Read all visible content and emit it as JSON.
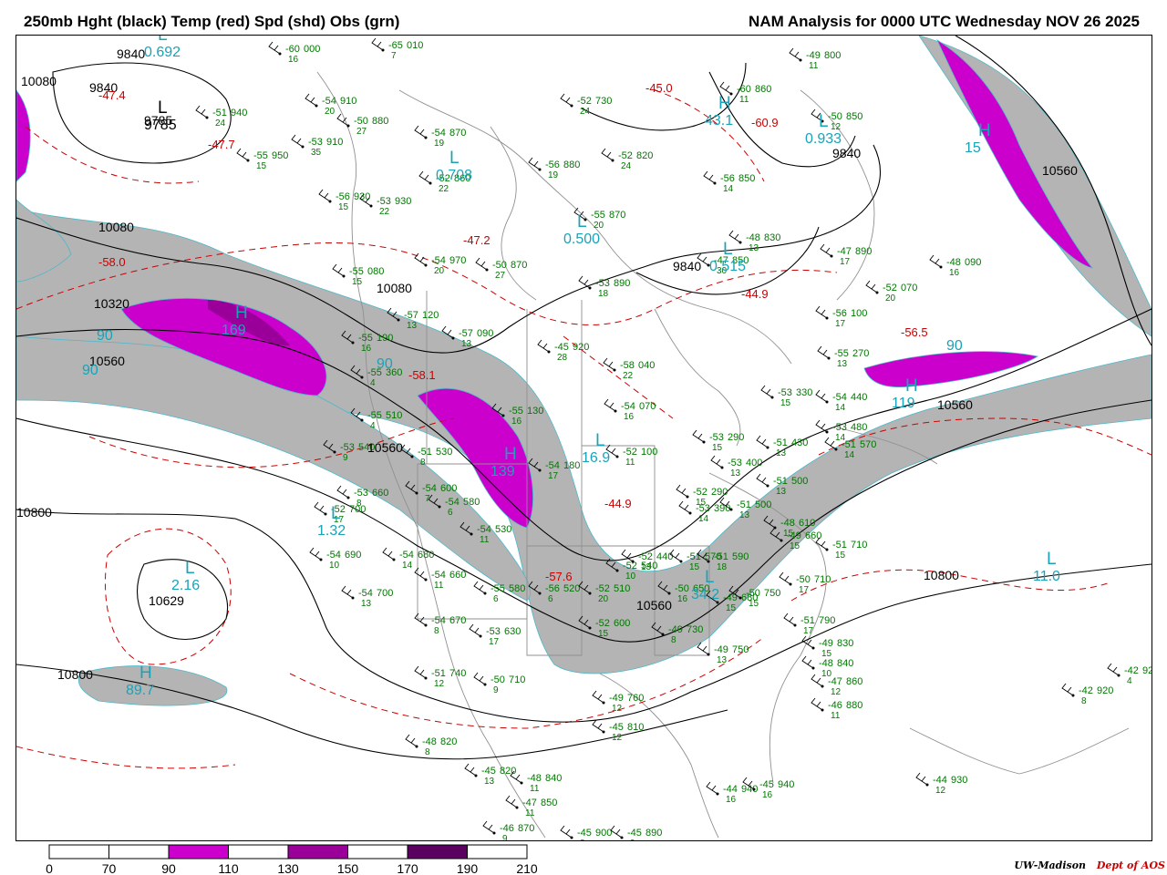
{
  "header": {
    "title_left": "250mb Hght (black) Temp (red) Spd (shd) Obs (grn)",
    "title_right": "NAM Analysis for 0000 UTC Wednesday  NOV 26 2025"
  },
  "colors": {
    "height": "#000000",
    "temperature": "#cc0000",
    "observations": "#007700",
    "speed_label": "#1aa3b8",
    "geography": "#909090",
    "shade_70": "#b4b4b4",
    "shade_110": "#cc00cc",
    "shade_150": "#9a0099",
    "shade_190": "#5a0060"
  },
  "speed_colorbar": {
    "ticks": [
      "0",
      "70",
      "90",
      "110",
      "130",
      "150",
      "170",
      "190",
      "210"
    ],
    "segment_colors": [
      "#ffffff",
      "#b4b4b4",
      "#ffffff",
      "#cc00cc",
      "#ffffff",
      "#9a0099",
      "#ffffff",
      "#5a0060",
      "#ffffff"
    ]
  },
  "height_labels": [
    "9840",
    "10080",
    "9840",
    "9785",
    "10080",
    "10320",
    "10560",
    "10080",
    "10560",
    "10800",
    "10629",
    "10800",
    "10560",
    "10800",
    "10560",
    "9840",
    "9840",
    "10560"
  ],
  "temperature_labels": [
    "-47.4",
    "-47.7",
    "-47.2",
    "-58.0",
    "-58.1",
    "-45.0",
    "-60.9",
    "-44.9",
    "-56.5",
    "-57.6",
    "-44.9"
  ],
  "pressure_centers": [
    {
      "letter": "L",
      "value": "0.692"
    },
    {
      "letter": "L",
      "value": "9785"
    },
    {
      "letter": "L",
      "value": "0.708"
    },
    {
      "letter": "L",
      "value": "0.500"
    },
    {
      "letter": "L",
      "value": "0.515"
    },
    {
      "letter": "H",
      "value": "43.1"
    },
    {
      "letter": "L",
      "value": "0.933"
    },
    {
      "letter": "H",
      "value": "15"
    },
    {
      "letter": "H",
      "value": "169"
    },
    {
      "letter": "H",
      "value": "119"
    },
    {
      "letter": "L",
      "value": "1.32"
    },
    {
      "letter": "L",
      "value": "2.16"
    },
    {
      "letter": "L",
      "value": "11.0"
    },
    {
      "letter": "H",
      "value": "89.7"
    },
    {
      "letter": "L",
      "value": "16.9"
    },
    {
      "letter": "L",
      "value": "34.2"
    },
    {
      "letter": "H",
      "value": "139"
    }
  ],
  "speed_labels": [
    "90",
    "90",
    "90",
    "90"
  ],
  "observations": [
    {
      "t": "-60",
      "h": "000",
      "s": "16"
    },
    {
      "t": "-65",
      "h": "010",
      "s": "7"
    },
    {
      "t": "-51",
      "h": "940",
      "s": "24"
    },
    {
      "t": "-54",
      "h": "910",
      "s": "20"
    },
    {
      "t": "-50",
      "h": "880",
      "s": "27"
    },
    {
      "t": "-53",
      "h": "910",
      "s": "35"
    },
    {
      "t": "-55",
      "h": "950",
      "s": "15"
    },
    {
      "t": "-54",
      "h": "870",
      "s": "19"
    },
    {
      "t": "-52",
      "h": "860",
      "s": "22"
    },
    {
      "t": "-56",
      "h": "930",
      "s": "15"
    },
    {
      "t": "-53",
      "h": "930",
      "s": "22"
    },
    {
      "t": "-54",
      "h": "970",
      "s": "20"
    },
    {
      "t": "-50",
      "h": "870",
      "s": "27"
    },
    {
      "t": "-55",
      "h": "080",
      "s": "15"
    },
    {
      "t": "-57",
      "h": "120",
      "s": "13"
    },
    {
      "t": "-57",
      "h": "090",
      "s": "13"
    },
    {
      "t": "-55",
      "h": "190",
      "s": "16"
    },
    {
      "t": "-56",
      "h": "880",
      "s": "19"
    },
    {
      "t": "-52",
      "h": "820",
      "s": "24"
    },
    {
      "t": "-52",
      "h": "730",
      "s": "24"
    },
    {
      "t": "-55",
      "h": "870",
      "s": "20"
    },
    {
      "t": "-53",
      "h": "890",
      "s": "18"
    },
    {
      "t": "-45",
      "h": "920",
      "s": "28"
    },
    {
      "t": "-49",
      "h": "800",
      "s": "11"
    },
    {
      "t": "-60",
      "h": "860",
      "s": "11"
    },
    {
      "t": "-50",
      "h": "850",
      "s": "12"
    },
    {
      "t": "-56",
      "h": "850",
      "s": "14"
    },
    {
      "t": "-48",
      "h": "830",
      "s": "13"
    },
    {
      "t": "-47",
      "h": "850",
      "s": "30"
    },
    {
      "t": "-47",
      "h": "890",
      "s": "17"
    },
    {
      "t": "-48",
      "h": "090",
      "s": "16"
    },
    {
      "t": "-52",
      "h": "070",
      "s": "20"
    },
    {
      "t": "-56",
      "h": "100",
      "s": "17"
    },
    {
      "t": "-55",
      "h": "270",
      "s": "13"
    },
    {
      "t": "-54",
      "h": "440",
      "s": "14"
    },
    {
      "t": "-53",
      "h": "330",
      "s": "15"
    },
    {
      "t": "-53",
      "h": "480",
      "s": "14"
    },
    {
      "t": "-51",
      "h": "430",
      "s": "13"
    },
    {
      "t": "-51",
      "h": "570",
      "s": "14"
    },
    {
      "t": "-53",
      "h": "290",
      "s": "15"
    },
    {
      "t": "-53",
      "h": "400",
      "s": "13"
    },
    {
      "t": "-51",
      "h": "500",
      "s": "13"
    },
    {
      "t": "-52",
      "h": "290",
      "s": "15"
    },
    {
      "t": "-53",
      "h": "390",
      "s": "14"
    },
    {
      "t": "-51",
      "h": "500",
      "s": "13"
    },
    {
      "t": "-48",
      "h": "610",
      "s": "15"
    },
    {
      "t": "-49",
      "h": "660",
      "s": "15"
    },
    {
      "t": "-51",
      "h": "710",
      "s": "15"
    },
    {
      "t": "-58",
      "h": "040",
      "s": "22"
    },
    {
      "t": "-54",
      "h": "070",
      "s": "16"
    },
    {
      "t": "-52",
      "h": "100",
      "s": "11"
    },
    {
      "t": "-55",
      "h": "130",
      "s": "16"
    },
    {
      "t": "-54",
      "h": "180",
      "s": "17"
    },
    {
      "t": "-55",
      "h": "360",
      "s": "4"
    },
    {
      "t": "-55",
      "h": "510",
      "s": "4"
    },
    {
      "t": "-53",
      "h": "540",
      "s": "9"
    },
    {
      "t": "-51",
      "h": "530",
      "s": "8"
    },
    {
      "t": "-53",
      "h": "660",
      "s": "8"
    },
    {
      "t": "-54",
      "h": "600",
      "s": "7"
    },
    {
      "t": "-54",
      "h": "580",
      "s": "6"
    },
    {
      "t": "-52",
      "h": "700",
      "s": "17"
    },
    {
      "t": "-54",
      "h": "690",
      "s": "10"
    },
    {
      "t": "-54",
      "h": "680",
      "s": "14"
    },
    {
      "t": "-54",
      "h": "530",
      "s": "11"
    },
    {
      "t": "-54",
      "h": "700",
      "s": "13"
    },
    {
      "t": "-54",
      "h": "660",
      "s": "11"
    },
    {
      "t": "-55",
      "h": "580",
      "s": "6"
    },
    {
      "t": "-56",
      "h": "520",
      "s": "6"
    },
    {
      "t": "-52",
      "h": "510",
      "s": "20"
    },
    {
      "t": "-52",
      "h": "540",
      "s": "10"
    },
    {
      "t": "-52",
      "h": "440",
      "s": "13"
    },
    {
      "t": "-51",
      "h": "570",
      "s": "15"
    },
    {
      "t": "-51",
      "h": "590",
      "s": "18"
    },
    {
      "t": "-50",
      "h": "650",
      "s": "16"
    },
    {
      "t": "-49",
      "h": "680",
      "s": "15"
    },
    {
      "t": "-50",
      "h": "750",
      "s": "15"
    },
    {
      "t": "-50",
      "h": "710",
      "s": "17"
    },
    {
      "t": "-51",
      "h": "790",
      "s": "17"
    },
    {
      "t": "-49",
      "h": "830",
      "s": "15"
    },
    {
      "t": "-48",
      "h": "840",
      "s": "10"
    },
    {
      "t": "-47",
      "h": "860",
      "s": "12"
    },
    {
      "t": "-46",
      "h": "880",
      "s": "11"
    },
    {
      "t": "-49",
      "h": "730",
      "s": "8"
    },
    {
      "t": "-49",
      "h": "750",
      "s": "13"
    },
    {
      "t": "-52",
      "h": "600",
      "s": "15"
    },
    {
      "t": "-54",
      "h": "670",
      "s": "8"
    },
    {
      "t": "-53",
      "h": "630",
      "s": "17"
    },
    {
      "t": "-51",
      "h": "740",
      "s": "12"
    },
    {
      "t": "-50",
      "h": "710",
      "s": "9"
    },
    {
      "t": "-49",
      "h": "760",
      "s": "12"
    },
    {
      "t": "-45",
      "h": "810",
      "s": "12"
    },
    {
      "t": "-48",
      "h": "820",
      "s": "8"
    },
    {
      "t": "-45",
      "h": "820",
      "s": "13"
    },
    {
      "t": "-48",
      "h": "840",
      "s": "11"
    },
    {
      "t": "-47",
      "h": "850",
      "s": "11"
    },
    {
      "t": "-46",
      "h": "870",
      "s": "9"
    },
    {
      "t": "-45",
      "h": "900",
      "s": "8"
    },
    {
      "t": "-45",
      "h": "890",
      "s": "9"
    },
    {
      "t": "-44",
      "h": "940",
      "s": "16"
    },
    {
      "t": "-45",
      "h": "940",
      "s": "16"
    },
    {
      "t": "-44",
      "h": "930",
      "s": "12"
    },
    {
      "t": "-42",
      "h": "920",
      "s": "8"
    },
    {
      "t": "-42",
      "h": "920",
      "s": "4"
    }
  ],
  "credit": {
    "institution": "UW-Madison",
    "department": "Dept of AOS"
  }
}
